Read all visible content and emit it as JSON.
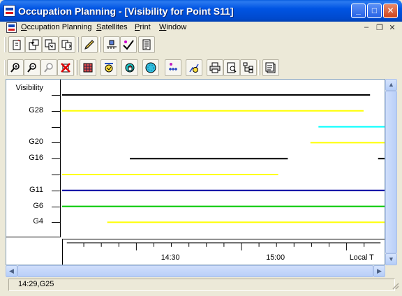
{
  "window": {
    "title": "Occupation Planning - [Visibility for Point S11]",
    "minimize": "_",
    "maximize": "□",
    "close": "✕"
  },
  "menu": {
    "items": [
      {
        "label": "Occupation Planning",
        "mnemonic": "O"
      },
      {
        "label": "Satellites",
        "mnemonic": "S"
      },
      {
        "label": "Print",
        "mnemonic": "P"
      },
      {
        "label": "Window",
        "mnemonic": "W"
      }
    ],
    "mdi_minimize": "–",
    "mdi_restore": "❐",
    "mdi_close": "✕"
  },
  "toolbar1": [
    "new-point-icon",
    "import-icon",
    "export-icon",
    "copy-points-icon",
    "edit-pencil-icon",
    "satellite-select-icon",
    "satellite-health-icon",
    "report-icon"
  ],
  "toolbar2": [
    "zoom-in-icon",
    "zoom-out-icon",
    "zoom-disabled-icon",
    "delete-icon",
    "grid-icon",
    "sky-plot-icon",
    "obstruction-icon",
    "globe-icon",
    "signal-icon",
    "dop-icon",
    "print-icon",
    "print-preview-icon",
    "tree-icon",
    "export-chart-icon"
  ],
  "chart_data": {
    "type": "gantt",
    "rows": [
      {
        "label": "Visibility",
        "color": "#000000",
        "segments": [
          [
            0.0,
            0.955
          ]
        ]
      },
      {
        "label": "G28",
        "color": "#ffff00",
        "segments": [
          [
            0.0,
            0.935
          ]
        ]
      },
      {
        "label": "",
        "color": "#00ffff",
        "segments": [
          [
            0.795,
            1.0
          ]
        ]
      },
      {
        "label": "G20",
        "color": "#ffff00",
        "segments": [
          [
            0.77,
            1.0
          ]
        ]
      },
      {
        "label": "G16",
        "color": "#000000",
        "segments": [
          [
            0.21,
            0.7
          ],
          [
            0.98,
            1.0
          ]
        ]
      },
      {
        "label": "",
        "color": "#ffff00",
        "segments": [
          [
            0.0,
            0.67
          ]
        ]
      },
      {
        "label": "G11",
        "color": "#0000a0",
        "segments": [
          [
            0.0,
            1.0
          ]
        ]
      },
      {
        "label": "G6",
        "color": "#00c800",
        "segments": [
          [
            0.0,
            1.0
          ]
        ]
      },
      {
        "label": "G4",
        "color": "#ffff00",
        "segments": [
          [
            0.14,
            1.0
          ]
        ]
      }
    ],
    "x_ticks": [
      {
        "label": "14:30",
        "pos": 0.33
      },
      {
        "label": "15:00",
        "pos": 0.665
      },
      {
        "label": "Local T",
        "pos": 0.94
      }
    ]
  },
  "status": {
    "text": "14:29,G25"
  }
}
